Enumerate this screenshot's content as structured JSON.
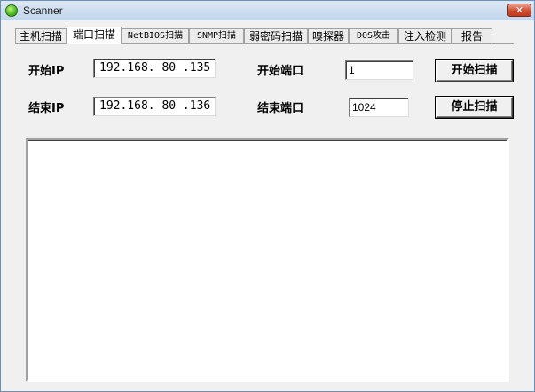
{
  "window": {
    "title": "Scanner",
    "close_glyph": "✕"
  },
  "tabs": [
    {
      "label": "主机扫描"
    },
    {
      "label": "端口扫描"
    },
    {
      "label": "NetBIOS扫描"
    },
    {
      "label": "SNMP扫描"
    },
    {
      "label": "弱密码扫描"
    },
    {
      "label": "嗅探器"
    },
    {
      "label": "DOS攻击"
    },
    {
      "label": "注入检测"
    },
    {
      "label": "报告"
    }
  ],
  "active_tab_index": 1,
  "form": {
    "start_ip_label": "开始IP",
    "start_ip_value": "192.168. 80 .135",
    "end_ip_label": "结束IP",
    "end_ip_value": "192.168. 80 .136",
    "start_port_label": "开始端口",
    "start_port_value": "1",
    "end_port_label": "结束端口",
    "end_port_value": "1024",
    "start_scan_button": "开始扫描",
    "stop_scan_button": "停止扫描"
  },
  "icons": {
    "app": "green-orb-icon",
    "close": "close-icon"
  }
}
